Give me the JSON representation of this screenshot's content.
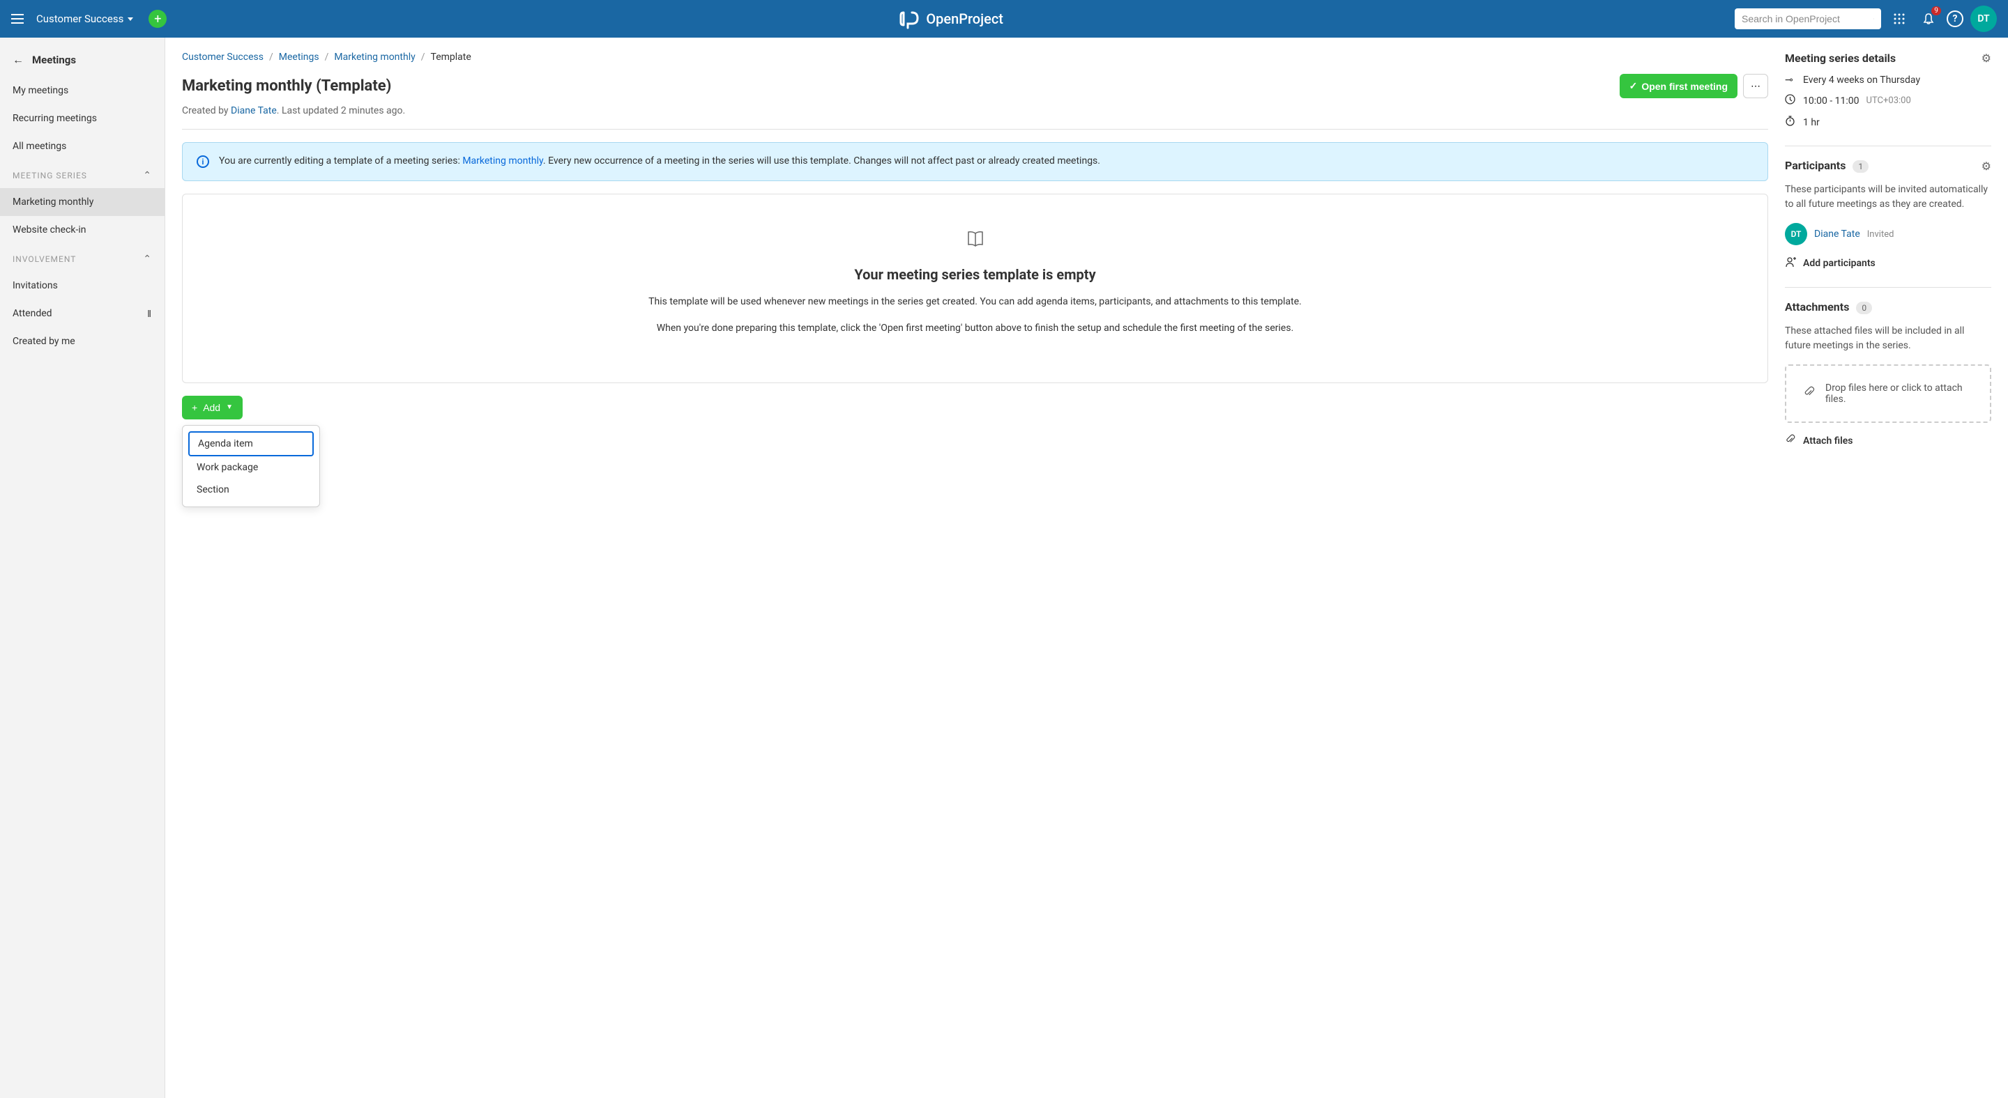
{
  "header": {
    "project_name": "Customer Success",
    "search_placeholder": "Search in OpenProject",
    "notification_count": "9",
    "avatar_initials": "DT",
    "logo_text": "OpenProject"
  },
  "sidebar": {
    "title": "Meetings",
    "items": {
      "my_meetings": "My meetings",
      "recurring_meetings": "Recurring meetings",
      "all_meetings": "All meetings"
    },
    "sections": {
      "meeting_series": "MEETING SERIES",
      "involvement": "INVOLVEMENT"
    },
    "series_items": {
      "marketing_monthly": "Marketing monthly",
      "website_checkin": "Website check-in"
    },
    "involvement_items": {
      "invitations": "Invitations",
      "attended": "Attended",
      "created_by_me": "Created by me"
    }
  },
  "breadcrumb": {
    "project": "Customer Success",
    "module": "Meetings",
    "series": "Marketing monthly",
    "current": "Template"
  },
  "page": {
    "title": "Marketing monthly (Template)",
    "open_button": "Open first meeting",
    "meta_prefix": "Created by ",
    "meta_author": "Diane Tate",
    "meta_suffix": ". Last updated 2 minutes ago."
  },
  "banner": {
    "prefix": "You are currently editing a template of a meeting series: ",
    "link": "Marketing monthly",
    "suffix": ". Every new occurrence of a meeting in the series will use this template. Changes will not affect past or already created meetings."
  },
  "empty_state": {
    "title": "Your meeting series template is empty",
    "line1": "This template will be used whenever new meetings in the series get created. You can add agenda items, participants, and attachments to this template.",
    "line2": "When you're done preparing this template, click the 'Open first meeting' button above to finish the setup and schedule the first meeting of the series."
  },
  "add": {
    "label": "Add",
    "items": {
      "agenda_item": "Agenda item",
      "work_package": "Work package",
      "section": "Section"
    }
  },
  "aside": {
    "series_details": {
      "title": "Meeting series details",
      "recurrence": "Every 4 weeks on Thursday",
      "time": "10:00 - 11:00",
      "timezone": "UTC+03:00",
      "duration": "1 hr"
    },
    "participants": {
      "title": "Participants",
      "count": "1",
      "description": "These participants will be invited automatically to all future meetings as they are created.",
      "user_name": "Diane Tate",
      "user_initials": "DT",
      "user_status": "Invited",
      "add_label": "Add participants"
    },
    "attachments": {
      "title": "Attachments",
      "count": "0",
      "description": "These attached files will be included in all future meetings in the series.",
      "dropzone_text": "Drop files here or click to attach files.",
      "attach_label": "Attach files"
    }
  }
}
